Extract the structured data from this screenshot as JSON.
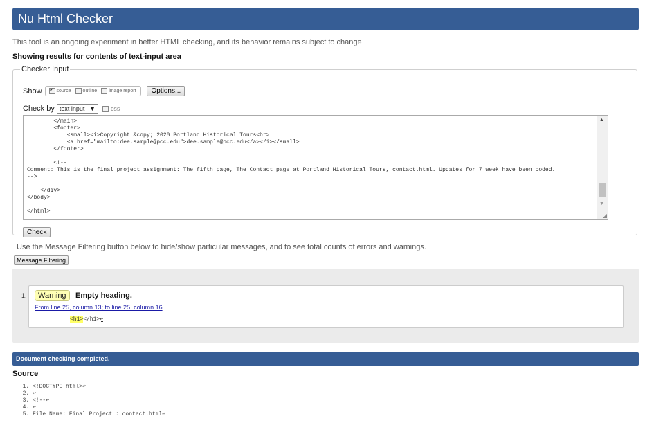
{
  "header": {
    "title": "Nu Html Checker"
  },
  "intro": "This tool is an ongoing experiment in better HTML checking, and its behavior remains subject to change",
  "showing": "Showing results for contents of text-input area",
  "checker": {
    "legend": "Checker Input",
    "show_label": "Show",
    "options": [
      {
        "label": "source",
        "checked": true
      },
      {
        "label": "outline",
        "checked": false
      },
      {
        "label": "image report",
        "checked": false
      }
    ],
    "options_button": "Options...",
    "check_by_label": "Check by",
    "check_by_value": "text input",
    "css_label": "css",
    "source_text": "        </main>\n        <footer>\n            <small><i>Copyright &copy; 2020 Portland Historical Tours<br>\n            <a href=\"mailto:dee.sample@pcc.edu\">dee.sample@pcc.edu</a></i></small>\n        </footer>\n\n        <!--\nComment: This is the final project assignment: The fifth page, The Contact page at Portland Historical Tours, contact.html. Updates for 7 week have been coded.\n-->\n\n    </div>\n</body>\n\n</html>",
    "check_button": "Check"
  },
  "filter": {
    "text": "Use the Message Filtering button below to hide/show particular messages, and to see total counts of errors and warnings.",
    "button": "Message Filtering"
  },
  "messages": [
    {
      "number": "1.",
      "type": "Warning",
      "text": "Empty heading.",
      "location": "From line 25, column 13; to line 25, column 16",
      "extract_highlight": "<h1>",
      "extract_rest": "</h1>",
      "extract_return": "↩"
    }
  ],
  "done": "Document checking completed.",
  "source": {
    "heading": "Source",
    "lines": [
      "<!DOCTYPE html>↩",
      "↩",
      "<!--↩",
      "↩",
      "File Name: Final Project : contact.html↩"
    ]
  },
  "colors": {
    "header_bg": "#365d95",
    "warning_bg": "#ffffb5",
    "highlight": "#ffff66"
  }
}
